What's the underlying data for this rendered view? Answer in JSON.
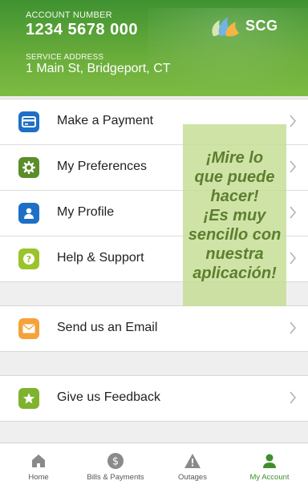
{
  "header": {
    "account_label": "ACCOUNT NUMBER",
    "account_number": "1234 5678 000",
    "service_label": "SERVICE ADDRESS",
    "service_address": "1 Main St, Bridgeport, CT",
    "logo_text": "SCG"
  },
  "menu": {
    "group1": [
      {
        "label": "Make a Payment",
        "icon": "credit-card-icon"
      },
      {
        "label": "My Preferences",
        "icon": "gear-icon"
      },
      {
        "label": "My Profile",
        "icon": "person-icon"
      },
      {
        "label": "Help & Support",
        "icon": "question-icon"
      }
    ],
    "group2": [
      {
        "label": "Send us an Email",
        "icon": "envelope-icon"
      }
    ],
    "group3": [
      {
        "label": "Give us Feedback",
        "icon": "star-icon"
      }
    ]
  },
  "promo": {
    "text": "¡Mire lo\nque puede\nhacer!\n¡Es muy\nsencillo con\nnuestra\naplicación!"
  },
  "tabbar": {
    "home": "Home",
    "bills": "Bills & Payments",
    "outages": "Outages",
    "account": "My Account",
    "active": "My Account"
  },
  "colors": {
    "brand_green": "#3f8f2c",
    "payment_blue": "#1e6fc6",
    "preferences_green": "#5a8e2a",
    "profile_blue": "#1e6fc6",
    "help_lime": "#9bc42b",
    "email_orange": "#f5a23a",
    "feedback_green": "#7fb32e"
  }
}
